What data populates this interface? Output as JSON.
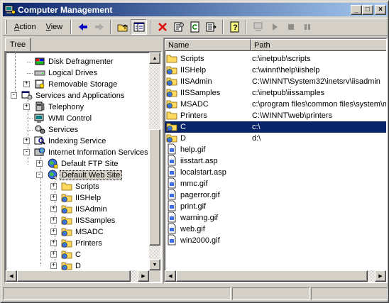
{
  "window": {
    "title": "Computer Management",
    "controls": {
      "minimize": "_",
      "maximize": "□",
      "close": "×"
    }
  },
  "toolbar": {
    "menus": [
      {
        "label": "Action",
        "accel": "A"
      },
      {
        "label": "View",
        "accel": "V"
      }
    ],
    "buttons": [
      {
        "icon": "back-arrow-icon"
      },
      {
        "icon": "forward-arrow-icon"
      },
      {
        "icon": "up-folder-icon"
      },
      {
        "icon": "show-hide-tree-icon"
      },
      {
        "icon": "delete-icon"
      },
      {
        "icon": "properties-icon"
      },
      {
        "icon": "refresh-icon"
      },
      {
        "icon": "export-list-icon"
      },
      {
        "icon": "help-icon"
      },
      {
        "icon": "connect-computer-icon"
      },
      {
        "icon": "play-icon"
      },
      {
        "icon": "stop-icon"
      },
      {
        "icon": "pause-icon"
      }
    ]
  },
  "tree": {
    "tab_label": "Tree",
    "nodes": [
      {
        "label": "Disk Defragmenter",
        "icon": "defrag-icon"
      },
      {
        "label": "Logical Drives",
        "icon": "drive-icon"
      },
      {
        "label": "Removable Storage",
        "icon": "removable-storage-icon",
        "expander": "+"
      },
      {
        "label": "Services and Applications",
        "icon": "services-apps-icon",
        "expander": "-"
      },
      {
        "label": "Telephony",
        "icon": "telephony-icon",
        "expander": "+"
      },
      {
        "label": "WMI Control",
        "icon": "wmi-icon"
      },
      {
        "label": "Services",
        "icon": "services-gear-icon"
      },
      {
        "label": "Indexing Service",
        "icon": "indexing-icon",
        "expander": "+"
      },
      {
        "label": "Internet Information Services",
        "icon": "iis-icon",
        "expander": "-"
      },
      {
        "label": "Default FTP Site",
        "icon": "ftp-globe-icon",
        "expander": "+"
      },
      {
        "label": "Default Web Site",
        "icon": "web-globe-icon",
        "expander": "-"
      },
      {
        "label": "Scripts",
        "icon": "folder-icon",
        "expander": "+"
      },
      {
        "label": "IISHelp",
        "icon": "virtual-dir-icon",
        "expander": "+"
      },
      {
        "label": "IISAdmin",
        "icon": "virtual-dir-icon",
        "expander": "+"
      },
      {
        "label": "IISSamples",
        "icon": "virtual-dir-icon",
        "expander": "+"
      },
      {
        "label": "MSADC",
        "icon": "virtual-dir-icon",
        "expander": "+"
      },
      {
        "label": "Printers",
        "icon": "virtual-dir-icon",
        "expander": "+"
      },
      {
        "label": "C",
        "icon": "virtual-dir-icon",
        "expander": "+"
      },
      {
        "label": "D",
        "icon": "virtual-dir-icon",
        "expander": "+"
      }
    ]
  },
  "list": {
    "columns": [
      "Name",
      "Path"
    ],
    "rows": [
      {
        "name": "Scripts",
        "path": "c:\\inetpub\\scripts",
        "icon": "folder-icon"
      },
      {
        "name": "IISHelp",
        "path": "c:\\winnt\\help\\iishelp",
        "icon": "virtual-dir-icon"
      },
      {
        "name": "IISAdmin",
        "path": "C:\\WINNT\\System32\\inetsrv\\iisadmin",
        "icon": "virtual-dir-icon"
      },
      {
        "name": "IISSamples",
        "path": "c:\\inetpub\\iissamples",
        "icon": "virtual-dir-icon"
      },
      {
        "name": "MSADC",
        "path": "c:\\program files\\common files\\system\\msadc",
        "icon": "virtual-dir-icon"
      },
      {
        "name": "Printers",
        "path": "C:\\WINNT\\web\\printers",
        "icon": "folder-icon"
      },
      {
        "name": "C",
        "path": "c:\\",
        "icon": "virtual-dir-icon",
        "selected": true
      },
      {
        "name": "D",
        "path": "d:\\",
        "icon": "virtual-dir-icon"
      },
      {
        "name": "help.gif",
        "path": "",
        "icon": "file-icon"
      },
      {
        "name": "iisstart.asp",
        "path": "",
        "icon": "file-icon"
      },
      {
        "name": "localstart.asp",
        "path": "",
        "icon": "file-icon"
      },
      {
        "name": "mmc.gif",
        "path": "",
        "icon": "file-icon"
      },
      {
        "name": "pagerror.gif",
        "path": "",
        "icon": "file-icon"
      },
      {
        "name": "print.gif",
        "path": "",
        "icon": "file-icon"
      },
      {
        "name": "warning.gif",
        "path": "",
        "icon": "file-icon"
      },
      {
        "name": "web.gif",
        "path": "",
        "icon": "file-icon"
      },
      {
        "name": "win2000.gif",
        "path": "",
        "icon": "file-icon"
      }
    ]
  },
  "status": {
    "panes": [
      "",
      "",
      ""
    ]
  },
  "colors": {
    "title_start": "#0a246a",
    "title_end": "#a6caf0",
    "selection": "#0a246a",
    "face": "#d4d0c8"
  }
}
